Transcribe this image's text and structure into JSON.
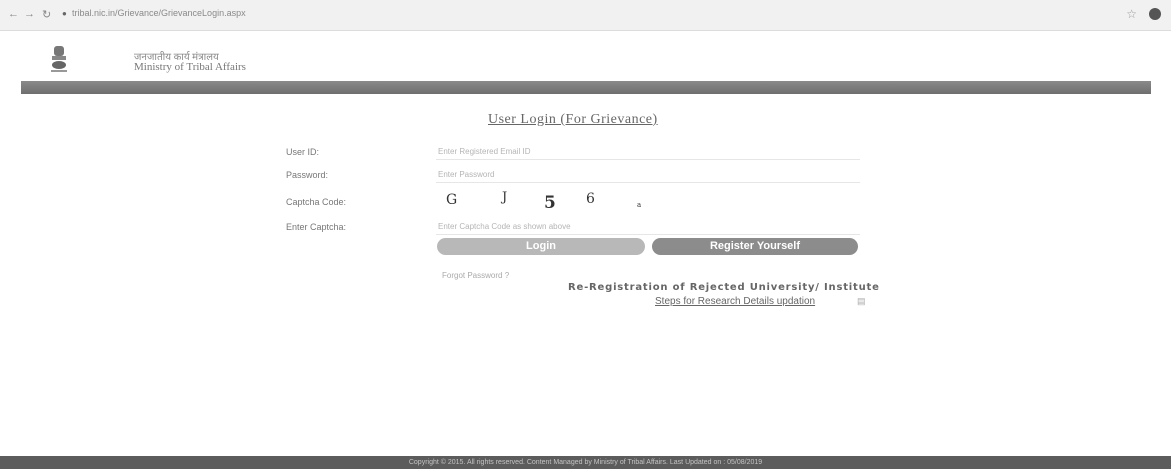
{
  "browser": {
    "url": "tribal.nic.in/Grievance/GrievanceLogin.aspx"
  },
  "header": {
    "hindi_name": "जनजातीय कार्य मंत्रालय",
    "ministry_name": "Ministry of Tribal Affairs"
  },
  "login": {
    "title": "User Login (For Grievance)",
    "user_id_label": "User ID:",
    "user_id_placeholder": "Enter Registered Email ID",
    "password_label": "Password:",
    "password_placeholder": "Enter Password",
    "captcha_label": "Captcha Code:",
    "captcha_chars": [
      "G",
      "J",
      "5",
      "6",
      "a"
    ],
    "enter_captcha_label": "Enter Captcha:",
    "enter_captcha_placeholder": "Enter Captcha Code as shown above",
    "login_button": "Login",
    "register_button": "Register Yourself",
    "forgot_password": "Forgot Password ?",
    "reregistration_link": "Re-Registration of Rejected University/ Institute",
    "steps_link": "Steps for Research Details updation"
  },
  "footer": {
    "text": "Copyright © 2015. All rights reserved. Content Managed by Ministry of Tribal Affairs. Last Updated on : 05/08/2019"
  }
}
